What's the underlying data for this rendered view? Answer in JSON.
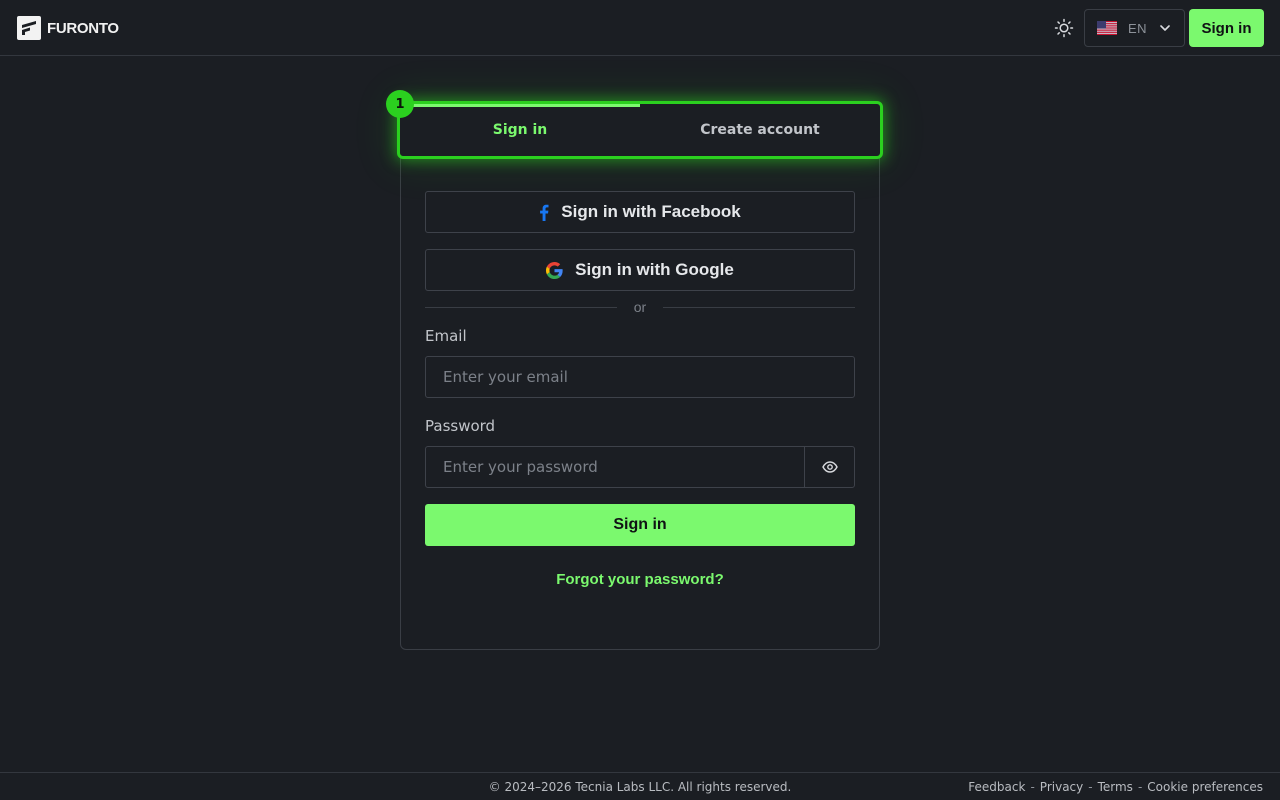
{
  "header": {
    "brand": "FURONTO",
    "language": {
      "code": "EN",
      "flag": "us-flag-icon"
    },
    "theme_icon": "sun-icon",
    "signin_label": "Sign in"
  },
  "step_badge": "1",
  "tabs": [
    {
      "label": "Sign in",
      "active": true
    },
    {
      "label": "Create account",
      "active": false
    }
  ],
  "social": {
    "facebook_label": "Sign in with Facebook",
    "google_label": "Sign in with Google"
  },
  "divider_text": "or",
  "form": {
    "email_label": "Email",
    "email_placeholder": "Enter your email",
    "password_label": "Password",
    "password_placeholder": "Enter your password",
    "submit_label": "Sign in",
    "forgot_label": "Forgot your password?"
  },
  "footer": {
    "copyright": "© 2024–2026 Tecnia Labs LLC. All rights reserved.",
    "links": [
      "Feedback",
      "Privacy",
      "Terms",
      "Cookie preferences"
    ]
  },
  "colors": {
    "accent": "#7bf96e",
    "highlight": "#2bd01f",
    "background": "#1b1e23"
  }
}
